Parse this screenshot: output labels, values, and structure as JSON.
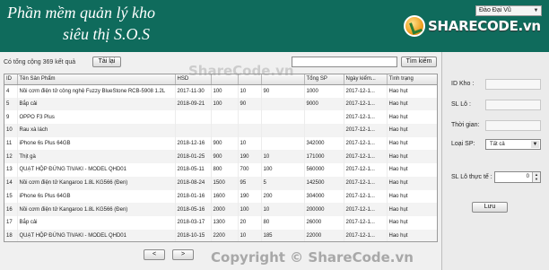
{
  "header": {
    "title_line1": "Phần mềm quản lý kho",
    "title_line2": "siêu thị S.O.S",
    "user_select_value": "Đào Đại Vũ",
    "logo_text": "SHARECODE.vn",
    "brand_color": "#0f6b5c"
  },
  "toolbar": {
    "count_text": "Có tổng cộng 369 kết quả",
    "reload_label": "Tải lại",
    "search_value": "",
    "search_label": "Tìm kiếm"
  },
  "table": {
    "columns": [
      "ID",
      "Tên Sản Phẩm",
      "HSD",
      "",
      "",
      "",
      "Tổng SP",
      "Ngày kiểm...",
      "Tình trạng"
    ],
    "rows": [
      [
        "4",
        "Nồi cơm điện tử công nghệ Fuzzy BlueStone RCB-5908 1.2L",
        "2017-11-30",
        "100",
        "10",
        "90",
        "1000",
        "2017-12-1...",
        "Hao hụt"
      ],
      [
        "5",
        "Bắp cải",
        "2018-09-21",
        "100",
        "90",
        "",
        "9000",
        "2017-12-1...",
        "Hao hụt"
      ],
      [
        "9",
        "OPPO F3 Plus",
        "",
        "",
        "",
        "",
        "",
        "2017-12-1...",
        "Hao hụt"
      ],
      [
        "10",
        "Rau xà lách",
        "",
        "",
        "",
        "",
        "",
        "2017-12-1...",
        "Hao hụt"
      ],
      [
        "11",
        "iPhone 6s Plus 64GB",
        "2018-12-16",
        "900",
        "10",
        "",
        "342000",
        "2017-12-1...",
        "Hao hụt"
      ],
      [
        "12",
        "Thịt gà",
        "2018-01-25",
        "900",
        "190",
        "10",
        "171000",
        "2017-12-1...",
        "Hao hụt"
      ],
      [
        "13",
        "QUẠT HỘP ĐỨNG TIVAKI - MODEL QHD01",
        "2018-05-11",
        "800",
        "700",
        "100",
        "560000",
        "2017-12-1...",
        "Hao hụt"
      ],
      [
        "14",
        "Nồi cơm điện tử Kangaroo 1.8L KG566 (Đen)",
        "2018-08-24",
        "1500",
        "95",
        "5",
        "142500",
        "2017-12-1...",
        "Hao hụt"
      ],
      [
        "15",
        "iPhone 6s Plus 64GB",
        "2018-01-16",
        "1600",
        "190",
        "200",
        "304000",
        "2017-12-1...",
        "Hao hụt"
      ],
      [
        "16",
        "Nồi cơm điện tử Kangaroo 1.8L KG566 (Đen)",
        "2018-05-16",
        "2000",
        "100",
        "10",
        "200000",
        "2017-12-1...",
        "Hao hụt"
      ],
      [
        "17",
        "Bắp cải",
        "2018-03-17",
        "1300",
        "20",
        "80",
        "26000",
        "2017-12-1...",
        "Hao hụt"
      ],
      [
        "18",
        "QUẠT HỘP ĐỨNG TIVAKI - MODEL QHD01",
        "2018-10-15",
        "2200",
        "10",
        "185",
        "22000",
        "2017-12-1...",
        "Hao hụt"
      ]
    ]
  },
  "form": {
    "id_label": "ID Kho :",
    "sl_label": "SL Lô :",
    "time_label": "Thời gian:",
    "type_label": "Loại SP:",
    "type_value": "Tất cả",
    "actual_label": "SL Lô thực tế :",
    "actual_value": "0",
    "save_label": "Lưu"
  },
  "pager": {
    "prev_label": "<",
    "next_label": ">"
  },
  "watermarks": {
    "top": "ShareCode.vn",
    "bottom": "Copyright © ShareCode.vn"
  }
}
